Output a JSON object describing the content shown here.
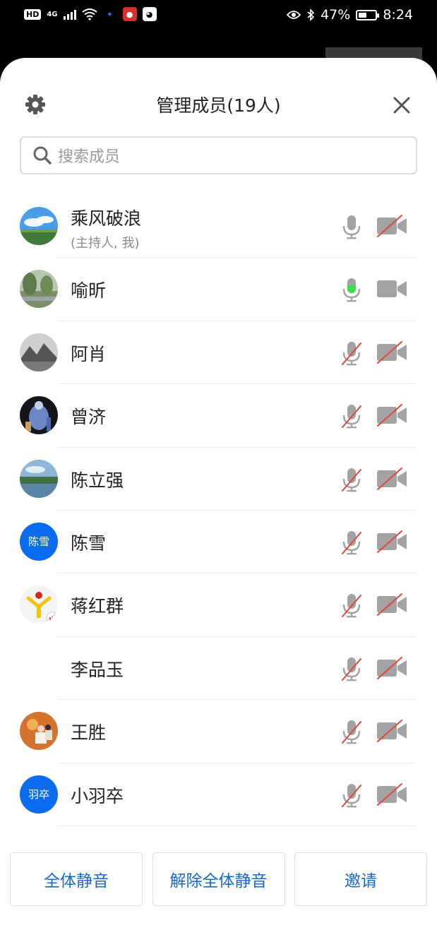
{
  "status_bar": {
    "hd": "HD",
    "network": "4G",
    "battery_percent": "47%",
    "battery_level": 0.47,
    "time": "8:24"
  },
  "header": {
    "title": "管理成员(19人)",
    "settings_icon": "gear-icon",
    "close_icon": "close-icon"
  },
  "search": {
    "placeholder": "搜索成员",
    "icon": "search-icon"
  },
  "members": [
    {
      "name": "乘风破浪",
      "subtitle": "(主持人, 我)",
      "avatar": "photo-sky",
      "mic": "off",
      "camera": "off"
    },
    {
      "name": "喻昕",
      "avatar": "photo-trees",
      "mic": "speaking",
      "camera": "on"
    },
    {
      "name": "阿肖",
      "avatar": "photo-mountain",
      "mic": "muted",
      "camera": "off"
    },
    {
      "name": "曾济",
      "avatar": "photo-statue",
      "mic": "muted",
      "camera": "off"
    },
    {
      "name": "陈立强",
      "avatar": "photo-lake",
      "mic": "muted",
      "camera": "off"
    },
    {
      "name": "陈雪",
      "avatar_text": "陈雪",
      "mic": "muted",
      "camera": "off"
    },
    {
      "name": "蒋红群",
      "avatar": "logo-yellow",
      "mic": "muted",
      "camera": "off"
    },
    {
      "name": "李品玉",
      "avatar": "none",
      "mic": "muted",
      "camera": "off"
    },
    {
      "name": "王胜",
      "avatar": "photo-people",
      "mic": "muted",
      "camera": "off"
    },
    {
      "name": "小羽卒",
      "avatar_text": "羽卒",
      "mic": "muted",
      "camera": "off"
    }
  ],
  "footer": {
    "mute_all": "全体静音",
    "unmute_all": "解除全体静音",
    "invite": "邀请"
  },
  "colors": {
    "accent": "#1769d8",
    "avatar_blue": "#0b6cf0",
    "speaking_green": "#3ddc4a",
    "muted_red": "#e2463c",
    "icon_gray": "#a0a0a0"
  }
}
